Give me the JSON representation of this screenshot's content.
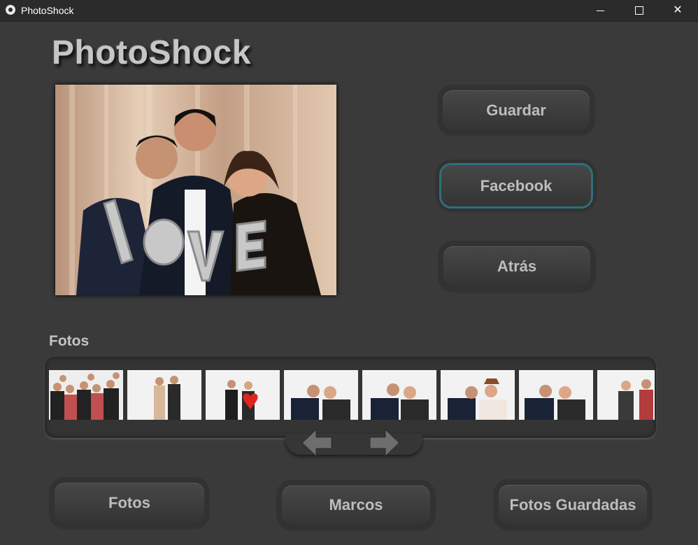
{
  "window": {
    "title": "PhotoShock"
  },
  "header": {
    "brand": "PhotoShock"
  },
  "actions": {
    "save": "Guardar",
    "facebook": "Facebook",
    "back": "Atrás"
  },
  "gallery": {
    "label": "Fotos",
    "thumbnail_count": 8
  },
  "bottom_nav": {
    "photos": "Fotos",
    "frames": "Marcos",
    "saved": "Fotos Guardadas"
  },
  "icons": {
    "app": "camera-icon",
    "minimize": "minimize-icon",
    "maximize": "maximize-icon",
    "close": "close-icon",
    "prev": "arrow-left-icon",
    "next": "arrow-right-icon"
  },
  "colors": {
    "background": "#3a3a3a",
    "button_text": "#bdbdbd",
    "focus_ring": "#2e6f7a"
  }
}
